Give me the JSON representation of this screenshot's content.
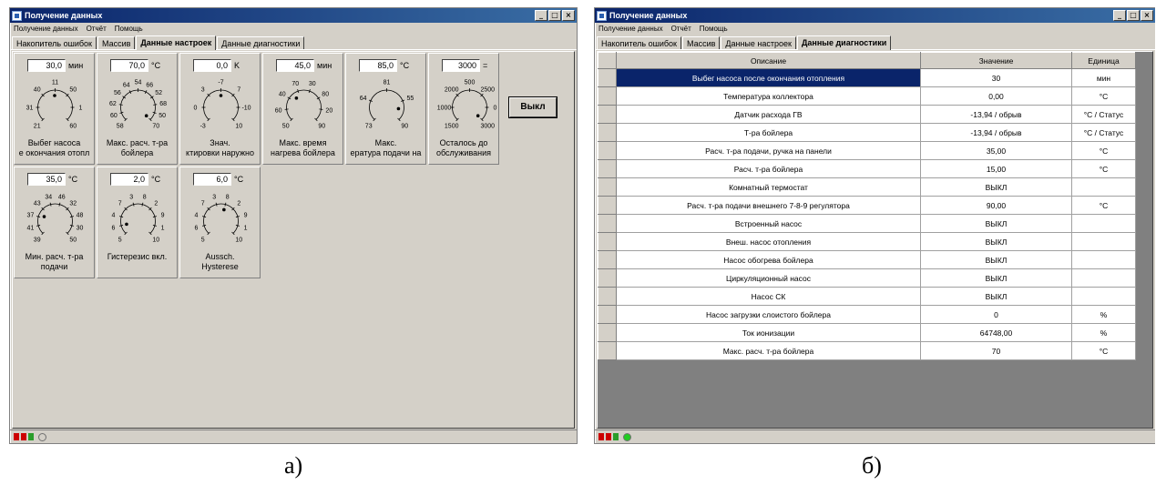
{
  "window_a": {
    "title": "Получение данных",
    "menu": [
      "Получение данных",
      "Отчёт",
      "Помощь"
    ],
    "tabs": [
      "Накопитель ошибок",
      "Массив",
      "Данные настроек",
      "Данные диагностики"
    ],
    "active_tab": 2,
    "dials_row1": [
      {
        "value": "30,0",
        "unit": "мин",
        "label": "Выбег насоса\nе окончания отопл",
        "ticks": [
          "21",
          "31",
          "40",
          "11",
          "50",
          "1",
          "60"
        ]
      },
      {
        "value": "70,0",
        "unit": "°C",
        "label": "Макс. расч. т-ра\nбойлера",
        "ticks": [
          "58",
          "60",
          "62",
          "56",
          "64",
          "54",
          "66",
          "52",
          "68",
          "50",
          "70"
        ]
      },
      {
        "value": "0,0",
        "unit": "K",
        "label": "Знач.\nктировки наружно",
        "ticks": [
          "-3",
          "0",
          "3",
          "-7",
          "7",
          "-10",
          "10"
        ]
      },
      {
        "value": "45,0",
        "unit": "мин",
        "label": "Макс. время\nнагрева бойлера",
        "ticks": [
          "50",
          "60",
          "40",
          "70",
          "30",
          "80",
          "20",
          "90"
        ]
      },
      {
        "value": "85,0",
        "unit": "°C",
        "label": "Макс.\nература подачи на",
        "ticks": [
          "73",
          "64",
          "81",
          "55",
          "90"
        ]
      },
      {
        "value": "3000",
        "unit": "=",
        "label": "Осталось до\nобслуживания",
        "ticks": [
          "1500",
          "1000",
          "2000",
          "500",
          "2500",
          "0",
          "3000"
        ]
      }
    ],
    "dials_row2": [
      {
        "value": "35,0",
        "unit": "°C",
        "label": "Мин. расч. т-ра\nподачи",
        "ticks": [
          "39",
          "41",
          "37",
          "43",
          "34",
          "46",
          "32",
          "48",
          "30",
          "50"
        ]
      },
      {
        "value": "2,0",
        "unit": "°C",
        "label": "Гистерезис вкл.",
        "ticks": [
          "5",
          "6",
          "4",
          "7",
          "3",
          "8",
          "2",
          "9",
          "1",
          "10"
        ]
      },
      {
        "value": "6,0",
        "unit": "°C",
        "label": "Aussch.\nHysterese",
        "ticks": [
          "5",
          "6",
          "4",
          "7",
          "3",
          "8",
          "2",
          "9",
          "1",
          "10"
        ]
      }
    ],
    "button_off": "Выкл",
    "status_colors": [
      "#cc0000",
      "#cc0000",
      "#2a9d2a"
    ],
    "led_color": "#d4d0c8"
  },
  "window_b": {
    "title": "Получение данных",
    "menu": [
      "Получение данных",
      "Отчёт",
      "Помощь"
    ],
    "tabs": [
      "Накопитель ошибок",
      "Массив",
      "Данные настроек",
      "Данные диагностики"
    ],
    "active_tab": 3,
    "table": {
      "columns": [
        "Описание",
        "Значение",
        "Единица"
      ],
      "selected_row": 0,
      "rows": [
        [
          "Выбег насоса после окончания отопления",
          "30",
          "мин"
        ],
        [
          "Температура коллектора",
          "0,00",
          "°C"
        ],
        [
          "Датчик расхода ГВ",
          "-13,94 / обрыв",
          "°C / Статус"
        ],
        [
          "Т-ра бойлера",
          "-13,94 / обрыв",
          "°C / Статус"
        ],
        [
          "Расч. т-ра подачи, ручка на панели",
          "35,00",
          "°C"
        ],
        [
          "Расч. т-ра бойлера",
          "15,00",
          "°C"
        ],
        [
          "Комнатный термостат",
          "ВЫКЛ",
          ""
        ],
        [
          "Расч. т-ра подачи внешнего 7-8-9 регулятора",
          "90,00",
          "°C"
        ],
        [
          "Встроенный насос",
          "ВЫКЛ",
          ""
        ],
        [
          "Внеш. насос отопления",
          "ВЫКЛ",
          ""
        ],
        [
          "Насос обогрева бойлера",
          "ВЫКЛ",
          ""
        ],
        [
          "Циркуляционный насос",
          "ВЫКЛ",
          ""
        ],
        [
          "Насос СК",
          "ВЫКЛ",
          ""
        ],
        [
          "Насос загрузки слоистого бойлера",
          "0",
          "%"
        ],
        [
          "Ток ионизации",
          "64748,00",
          "%"
        ],
        [
          "Макс. расч. т-ра бойлера",
          "70",
          "°C"
        ]
      ]
    },
    "status_colors": [
      "#cc0000",
      "#cc0000",
      "#2a9d2a"
    ],
    "led_color": "#22cc22"
  },
  "captions": [
    "а)",
    "б)"
  ]
}
